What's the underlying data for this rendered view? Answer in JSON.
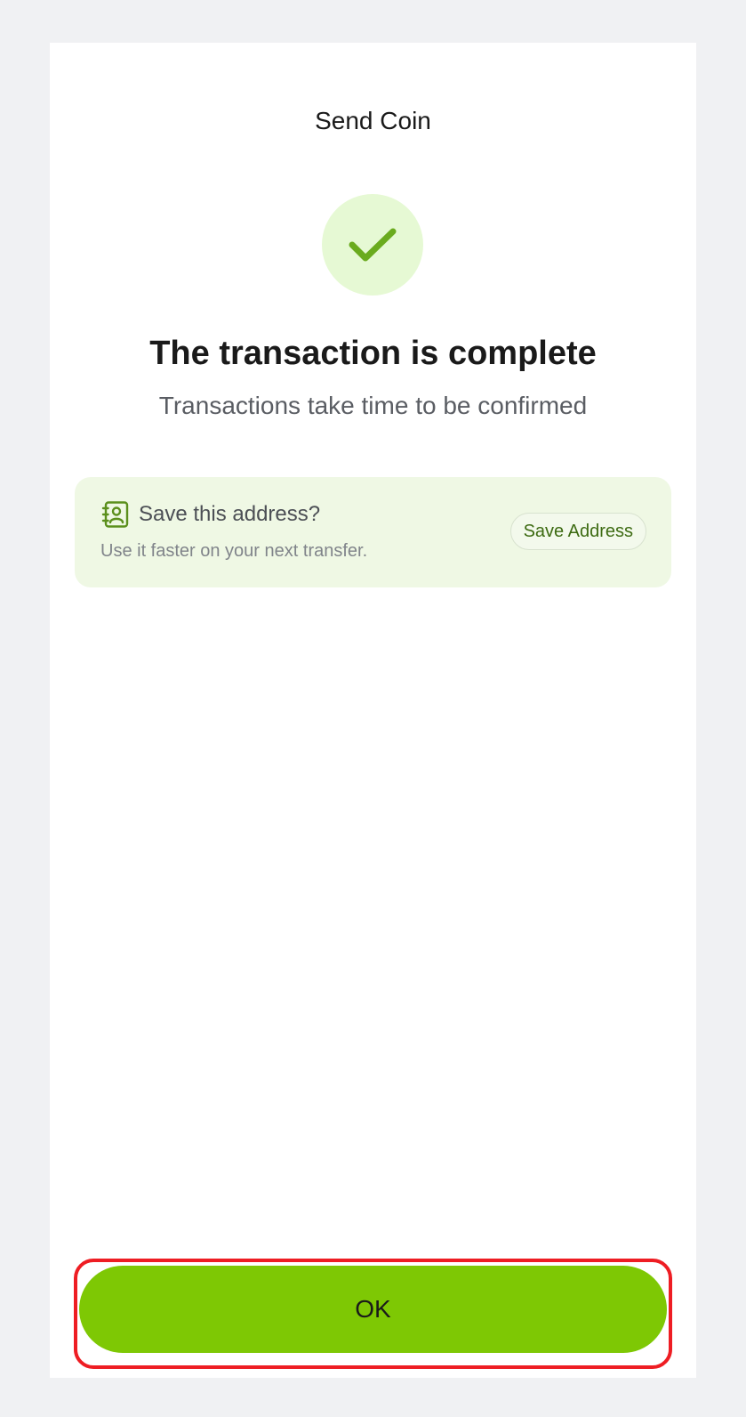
{
  "header": {
    "title": "Send Coin"
  },
  "status": {
    "icon": "checkmark-icon",
    "heading": "The transaction is complete",
    "subheading": "Transactions take time to be confirmed"
  },
  "save_card": {
    "icon": "address-book-icon",
    "title": "Save this address?",
    "description": "Use it faster on your next transfer.",
    "button_label": "Save Address"
  },
  "footer": {
    "ok_label": "OK"
  },
  "colors": {
    "accent": "#7ec804",
    "success_bg": "#e6f9d4",
    "check": "#6aab1e",
    "card_bg": "#eff8e4",
    "highlight": "#ee1d23"
  }
}
